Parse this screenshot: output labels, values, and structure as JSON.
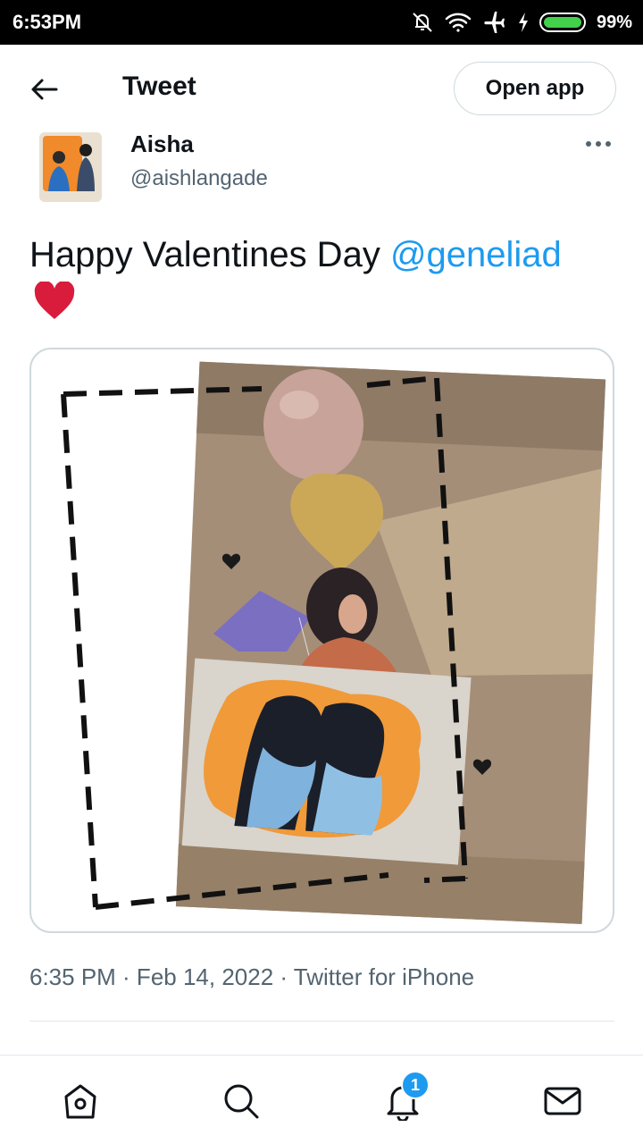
{
  "status_bar": {
    "time": "6:53PM",
    "battery": "99%",
    "icons": [
      "notifications-off-icon",
      "wifi-icon",
      "airplane-icon",
      "charging-icon",
      "battery-icon"
    ]
  },
  "header": {
    "title": "Tweet",
    "open_app_label": "Open app"
  },
  "tweet": {
    "author_name": "Aisha",
    "author_handle": "@aishlangade",
    "text_before": "Happy Valentines Day ",
    "mention": "@geneliad",
    "emoji": "red-heart-icon",
    "timestamp": "6:35 PM · Feb 14, 2022 · Twitter for iPhone"
  },
  "bottom_nav": {
    "items": [
      "home-icon",
      "search-icon",
      "notifications-icon",
      "messages-icon"
    ],
    "notification_count": "1"
  },
  "colors": {
    "link": "#1d9bf0",
    "text": "#0f1419",
    "secondary": "#536471",
    "border": "#cfd9de",
    "heart": "#d91c3c"
  }
}
